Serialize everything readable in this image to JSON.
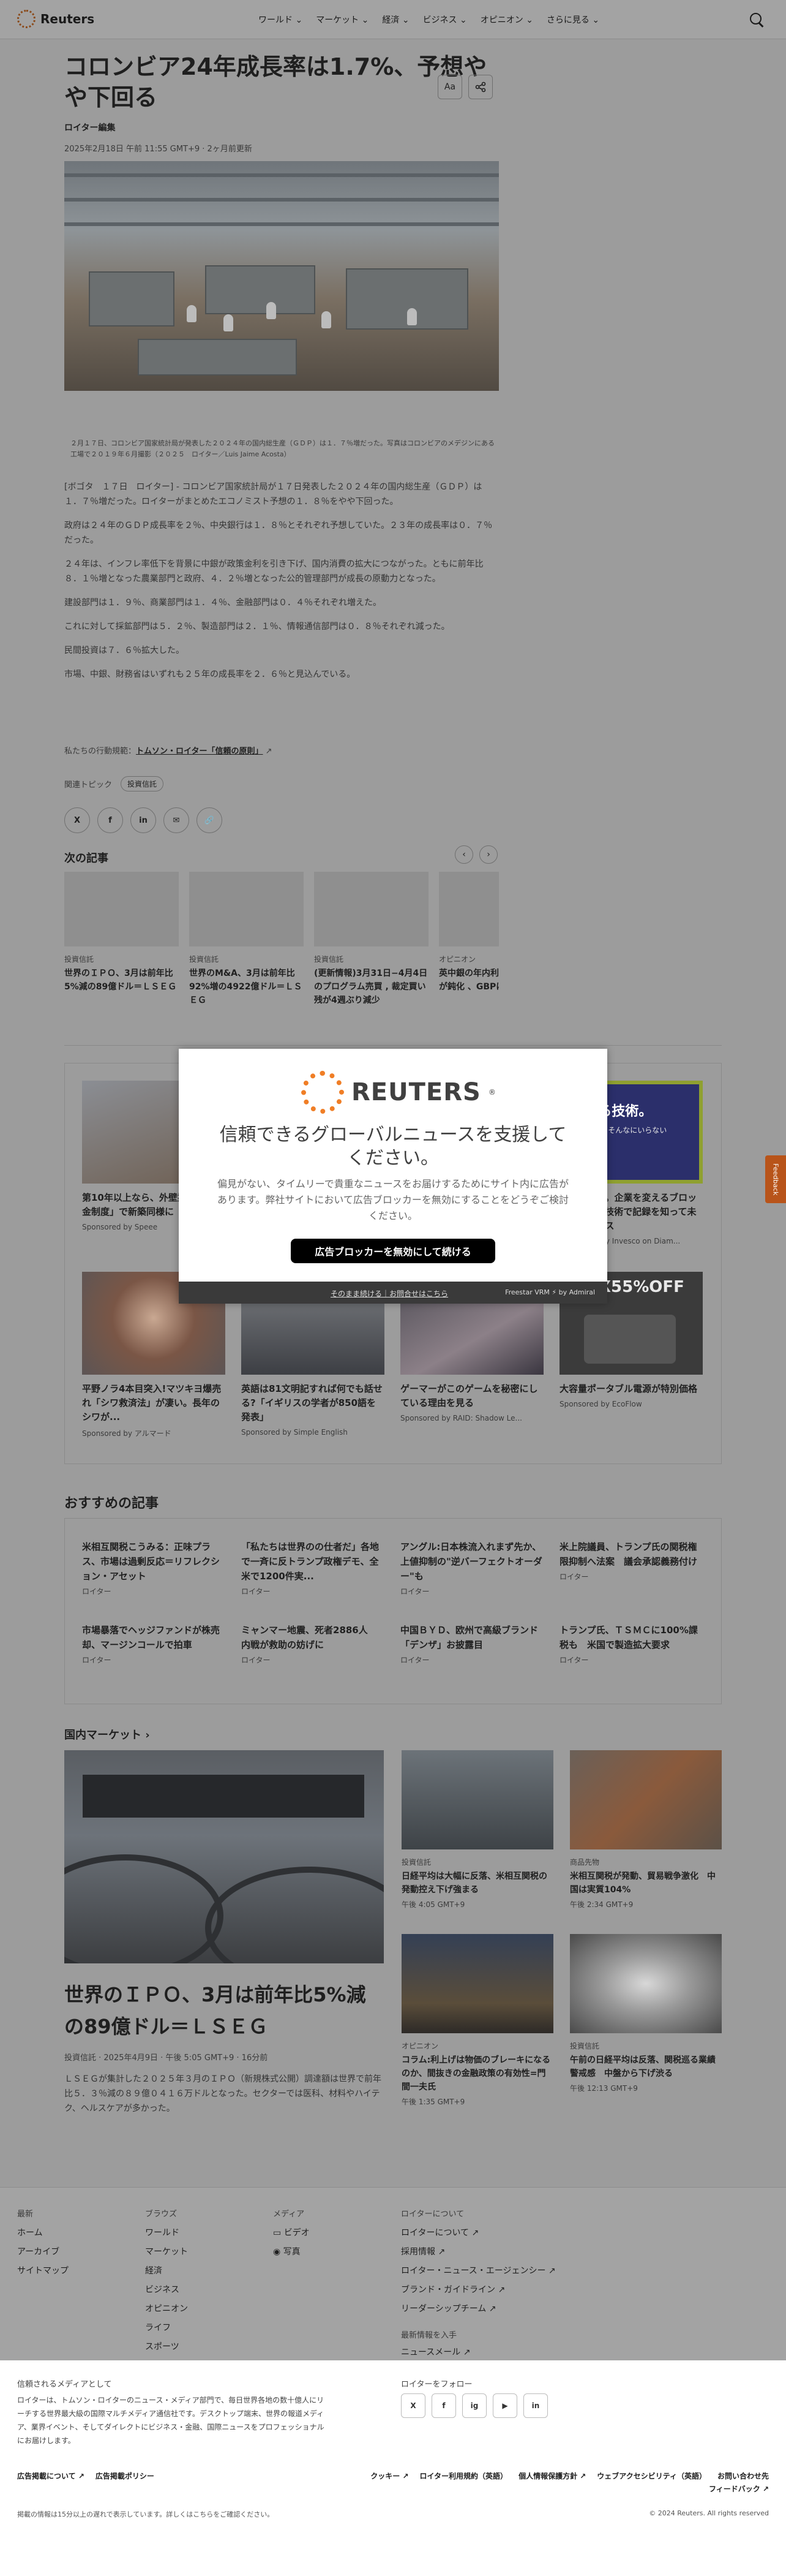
{
  "header": {
    "logo_text": "Reuters",
    "nav": [
      "ワールド",
      "マーケット",
      "経済",
      "ビジネス",
      "オピニオン",
      "さらに見る"
    ]
  },
  "article": {
    "title": "コロンビア24年成長率は1.7%、予想やや下回る",
    "author": "ロイター編集",
    "dateline": "2025年2月18日 午前 11:55 GMT+9 · 2ヶ月前更新",
    "text_size_button": "Aa",
    "caption": "２月１７日、コロンビア国家統計局が発表した２０２４年の国内総生産（ＧＤＰ）は１．７％増だった。写真はコロンビアのメデジンにある工場で２０１９年６月撮影（２０２５　ロイター／Luis Jaime Acosta）",
    "paragraphs": [
      "[ボゴタ　１７日　ロイター] - コロンビア国家統計局が１７日発表した２０２４年の国内総生産（ＧＤＰ）は１．７％増だった。ロイターがまとめたエコノミスト予想の１．８％をやや下回った。",
      "政府は２４年のＧＤＰ成長率を２％、中央銀行は１．８％とそれぞれ予想していた。２３年の成長率は０．７％だった。",
      "２４年は、インフレ率低下を背景に中銀が政策金利を引き下げ、国内消費の拡大につながった。ともに前年比８．１％増となった農業部門と政府、４．２％増となった公的管理部門が成長の原動力となった。",
      "建設部門は１．９％、商業部門は１．４％、金融部門は０．４％それぞれ増えた。",
      "これに対して採鉱部門は５．２％、製造部門は２．１％、情報通信部門は０．８％それぞれ減った。",
      "民間投資は７．６％拡大した。",
      "市場、中銀、財務省はいずれも２５年の成長率を２．６％と見込んでいる。"
    ],
    "trust_prefix": "私たちの行動規範：",
    "trust_link": "トムソン・ロイター「信頼の原則」",
    "topics_label": "関連トピック",
    "topic_chip": "投資信託",
    "share_icons": [
      "X",
      "f",
      "in",
      "✉",
      "🔗"
    ]
  },
  "next": {
    "title": "次の記事",
    "cards": [
      {
        "kicker": "投資信託",
        "headline": "世界のＩＰＯ、3月は前年比5%減の89億ドル＝ＬＳＥＧ"
      },
      {
        "kicker": "投資信託",
        "headline": "世界のM&A、3月は前年比92%増の4922億ドル＝ＬＳＥＧ"
      },
      {
        "kicker": "投資信託",
        "headline": "(更新情報)3月31日−4月4日のプログラム売買 , 裁定買い残が4週ぶり減少"
      },
      {
        "kicker": "オピニオン",
        "headline": "英中銀の年内利下げ織り込みが鈍化 、GBPに拡大"
      }
    ]
  },
  "sponsored": {
    "cards": [
      {
        "title": "第10年以上なら、外壁塗装「助成金制度」で新築同様に",
        "by": "Sponsored by Speee"
      },
      {
        "title": "",
        "by": ""
      },
      {
        "title": "",
        "by": ""
      },
      {
        "title": "変える技術。企業を変えるブロックチェーン技術で記録を知って未来にチャンス",
        "by": "Sponsored by Invesco on Diam..."
      },
      {
        "title": "平野ノラ4本目突入!マツキヨ爆売れ「シワ救済法」が凄い。長年のシワが...",
        "by": "Sponsored by アルマード"
      },
      {
        "title": "英語は81文明記すれば何でも話せる?「イギリスの学者が850語を発表」",
        "by": "Sponsored by Simple English"
      },
      {
        "title": "ゲーマーがこのゲームを秘密にしている理由を見る",
        "by": "Sponsored by RAID: Shadow Le..."
      },
      {
        "title": "大容量ポータブル電源が特別価格",
        "by": "Sponsored by EcoFlow"
      }
    ],
    "ad_banner_text": "変える技術。",
    "ad_banner_sub": "少しずつ、そんなにいらない",
    "ad_sale_text": "MAX55%OFF"
  },
  "modal": {
    "logo_word": "REUTERS",
    "headline": "信頼できるグローバルニュースを支援してください。",
    "subtext": "偏見がない、タイムリーで貴重なニュースをお届けするためにサイト内に広告があります。弊社サイトにおいて広告ブロッカーを無効にすることをどうぞご検討ください。",
    "cta": "広告ブロッカーを無効にして続ける",
    "footer_links": "そのまま続ける｜お問合せはこちら",
    "powered_by": "Freestar VRM ⚡ by Admiral"
  },
  "feedback_label": "Feedback",
  "recommended": {
    "title": "おすすめの記事",
    "items": [
      {
        "headline": "米相互関税こうみる：正味プラス、市場は過剰反応＝リフレクション・アセット",
        "source": "ロイター"
      },
      {
        "headline": "「私たちは世界のの仕者だ」各地で一斉に反トランプ政権デモ、全米で1200件実...",
        "source": "ロイター"
      },
      {
        "headline": "アングル:日本株流入れまず先か、上値抑制の\"逆バーフェクトオーダー\"も",
        "source": "ロイター"
      },
      {
        "headline": "米上院議員、トランプ氏の関税権限抑制へ法案　議会承認義務付け",
        "source": "ロイター"
      },
      {
        "headline": "市場暴落でヘッジファンドが株売却、マージンコールで拍車",
        "source": "ロイター"
      },
      {
        "headline": "ミャンマー地震、死者2886人　内戦が救助の妨げに",
        "source": "ロイター"
      },
      {
        "headline": "中国ＢＹＤ、欧州で高級ブランド「デンザ」お披露目",
        "source": "ロイター"
      },
      {
        "headline": "トランプ氏、ＴＳＭＣに100%課税も　米国で製造拡大要求",
        "source": "ロイター"
      }
    ]
  },
  "markets": {
    "title": "国内マーケット ›",
    "lead": {
      "headline": "世界のＩＰＯ、3月は前年比5%減の89億ドル＝ＬＳＥＧ",
      "meta": "投資信託 · 2025年4月9日 · 午後 5:05 GMT+9 · 16分前",
      "summary": "ＬＳＥＧが集計した２０２５年３月のＩＰＯ（新規株式公開）調達額は世界で前年比５．３％減の８９億０４１６万ドルとなった。セクターでは医科、材料やハイテク、ヘルスケアが多かった。"
    },
    "cards": [
      {
        "kicker": "投資信託",
        "headline": "日経平均は大幅に反落、米相互関税の発動控え下げ強まる",
        "time": "午後 4:05 GMT+9"
      },
      {
        "kicker": "商品先物",
        "headline": "米相互関税が発動、貿易戦争激化　中国は実質104%",
        "time": "午後 2:34 GMT+9"
      },
      {
        "kicker": "オピニオン",
        "headline": "コラム:利上げは物価のブレーキになるのか、間抜きの金融政策の有効性=門間一夫氏",
        "time": "午後 1:35 GMT+9"
      },
      {
        "kicker": "投資信託",
        "headline": "午前の日経平均は反落、関税巡る業績警戒感　中盤から下げ渋る",
        "time": "午後 12:13 GMT+9"
      }
    ]
  },
  "footer": {
    "columns": [
      {
        "heading": "最新",
        "items": [
          "ホーム",
          "アーカイブ",
          "サイトマップ"
        ]
      },
      {
        "heading": "ブラウズ",
        "items": [
          "ワールド",
          "マーケット",
          "経済",
          "ビジネス",
          "オピニオン",
          "ライフ",
          "スポーツ"
        ]
      },
      {
        "heading": "メディア",
        "items": [
          "ビデオ",
          "写真"
        ]
      },
      {
        "heading": "ロイターについて",
        "items": [
          "ロイターについて ↗",
          "採用情報 ↗",
          "ロイター・ニュース・エージェンシー ↗",
          "ブランド・ガイドライン ↗",
          "リーダーシップチーム ↗"
        ]
      }
    ],
    "latest_heading": "最新情報を入手",
    "newsletter": "ニュースメール ↗",
    "trust_heading": "信頼されるメディアとして",
    "trust_text": "ロイターは、トムソン・ロイターのニュース・メディア部門で、毎日世界各地の数十億人にリーチする世界最大級の国際マルチメディア通信社です。デスクトップ端末、世界の報道メディア、業界イベント、そしてダイレクトにビジネス・金融、国際ニュースをプロフェッショナルにお届けします。",
    "follow_heading": "ロイターをフォロー",
    "social": [
      "X",
      "f",
      "ig",
      "▶",
      "in"
    ],
    "legal_left": [
      "広告掲載について ↗",
      "広告掲載ポリシー"
    ],
    "legal_right": [
      "クッキー ↗",
      "ロイター利用規約（英語）",
      "個人情報保護方針 ↗",
      "ウェブアクセシビリティ（英語）",
      "お問い合わせ先",
      "フィードバック ↗"
    ],
    "note": "掲載の情報は15分以上の遅れで表示しています。詳しくはこちらをご確認ください。",
    "copyright": "© 2024 Reuters. All rights reserved"
  }
}
